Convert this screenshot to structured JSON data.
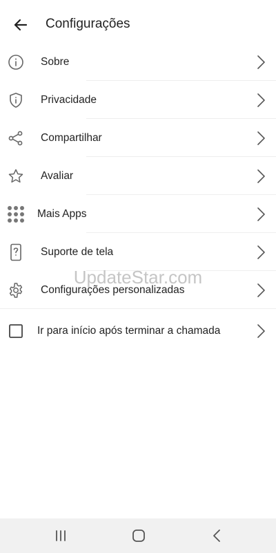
{
  "header": {
    "title": "Configurações",
    "back_icon": "arrow-left-icon"
  },
  "settings": [
    {
      "label": "Sobre",
      "icon": "info-icon"
    },
    {
      "label": "Privacidade",
      "icon": "shield-icon"
    },
    {
      "label": "Compartilhar",
      "icon": "share-icon"
    },
    {
      "label": "Avaliar",
      "icon": "star-icon"
    },
    {
      "label": "Mais Apps",
      "icon": "grid-icon"
    },
    {
      "label": "Suporte de tela",
      "icon": "phone-help-icon"
    },
    {
      "label": "Configurações personalizadas",
      "icon": "gear-icon"
    },
    {
      "label": "Ir para início após terminar a chamada",
      "icon": "checkbox-icon",
      "checked": false
    }
  ],
  "watermark": "UpdateStar.com",
  "navbar": {
    "recents_icon": "recents-icon",
    "home_icon": "home-icon",
    "back_icon": "back-icon",
    "background": "#f1f1f1"
  },
  "colors": {
    "icon": "#666666",
    "text": "#222222",
    "divider": "#eeeeee"
  }
}
